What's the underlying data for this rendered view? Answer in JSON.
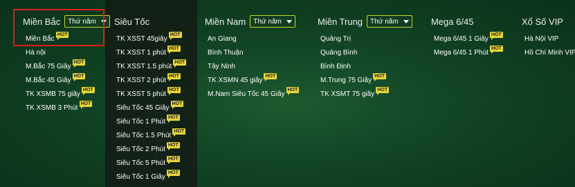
{
  "menu": {
    "columns": [
      {
        "title": "Miền Bắc",
        "dropdown": "Thứ năm",
        "items": [
          {
            "label": "Miền Bắc",
            "hot": "HOT"
          },
          {
            "label": "Hà nội"
          },
          {
            "label": "M.Bắc 75 Giây",
            "hot": "HOT"
          },
          {
            "label": "M.Bắc 45 Giây",
            "hot": "HOT"
          },
          {
            "label": "TK XSMB 75 giây",
            "hot": "HOT"
          },
          {
            "label": "TK XSMB 3 Phút",
            "hot": "HOT"
          }
        ]
      },
      {
        "title": "Siêu Tốc",
        "items": [
          {
            "label": "TK XSST 45giây",
            "hot": "HOT"
          },
          {
            "label": "TK XSST 1 phút",
            "hot": "HOT"
          },
          {
            "label": "TK XSST 1.5 phút",
            "hot": "HOT"
          },
          {
            "label": "TK XSST 2 phút",
            "hot": "HOT"
          },
          {
            "label": "TK XSST 5 phút",
            "hot": "HOT"
          },
          {
            "label": "Siêu Tốc 45 Giây",
            "hot": "HOT"
          },
          {
            "label": "Siêu Tốc 1 Phút",
            "hot": "HOT"
          },
          {
            "label": "Siêu Tốc 1.5 Phút",
            "hot": "HOT"
          },
          {
            "label": "Siêu Tốc 2 Phút",
            "hot": "HOT"
          },
          {
            "label": "Siêu Tốc 5 Phút",
            "hot": "HOT"
          },
          {
            "label": "Siêu Tốc 1 Giây",
            "hot": "HOT"
          }
        ]
      },
      {
        "title": "Miền Nam",
        "dropdown": "Thứ năm",
        "items": [
          {
            "label": "An Giang"
          },
          {
            "label": "Bình Thuận"
          },
          {
            "label": "Tây Ninh"
          },
          {
            "label": "TK XSMN 45 giây",
            "hot": "HOT"
          },
          {
            "label": "M.Nam Siêu Tốc 45 Giây",
            "hot": "HOT"
          }
        ]
      },
      {
        "title": "Miền Trung",
        "dropdown": "Thứ năm",
        "items": [
          {
            "label": "Quảng Trị"
          },
          {
            "label": "Quảng Bình"
          },
          {
            "label": "Bình Định"
          },
          {
            "label": "M.Trung 75 Giây",
            "hot": "HOT"
          },
          {
            "label": "TK XSMT 75 giây",
            "hot": "HOT"
          }
        ]
      },
      {
        "title": "Mega 6/45",
        "items": [
          {
            "label": "Mega 6/45 1 Giây",
            "hot": "HOT"
          },
          {
            "label": "Mega 6/45 1 Phút",
            "hot": "HOT"
          }
        ]
      },
      {
        "title": "Xổ Số VIP",
        "items": [
          {
            "label": "Hà Nội VIP"
          },
          {
            "label": "Hồ Chí Minh VIP"
          }
        ]
      }
    ]
  },
  "colors": {
    "background": "#0f3a1f",
    "dropdown_border": "#c7d62c",
    "hot_badge": "#e8d63a",
    "highlight_box": "#e01e1e"
  }
}
